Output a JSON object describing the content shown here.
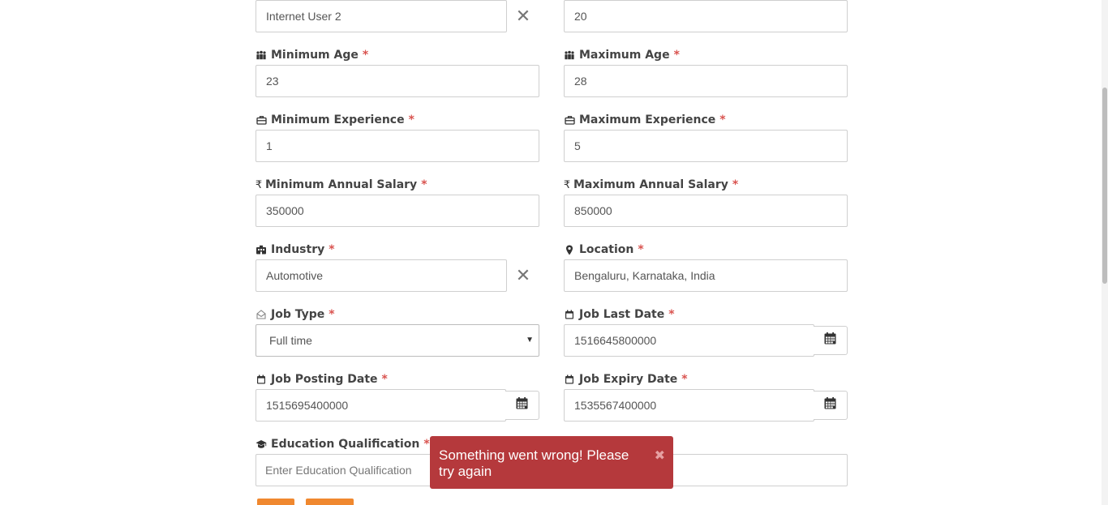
{
  "form": {
    "top_left_value": "Internet User 2",
    "top_right_value": "20",
    "min_age": {
      "label": "Minimum Age",
      "value": "23"
    },
    "max_age": {
      "label": "Maximum Age",
      "value": "28"
    },
    "min_experience": {
      "label": "Minimum Experience",
      "value": "1"
    },
    "max_experience": {
      "label": "Maximum Experience",
      "value": "5"
    },
    "min_salary": {
      "label": "Minimum Annual Salary",
      "value": "350000"
    },
    "max_salary": {
      "label": "Maximum Annual Salary",
      "value": "850000"
    },
    "industry": {
      "label": "Industry",
      "value": "Automotive"
    },
    "location": {
      "label": "Location",
      "value": "Bengaluru, Karnataka, India"
    },
    "job_type": {
      "label": "Job Type",
      "selected": "Full time"
    },
    "job_last_date": {
      "label": "Job Last Date",
      "value": "1516645800000"
    },
    "job_posting_date": {
      "label": "Job Posting Date",
      "value": "1515695400000"
    },
    "job_expiry_date": {
      "label": "Job Expiry Date",
      "value": "1535567400000"
    },
    "education": {
      "label": "Education Qualification",
      "placeholder": "Enter Education Qualification"
    },
    "required_mark": "*"
  },
  "toast": {
    "message": "Something went wrong! Please try again",
    "close_glyph": "✖",
    "color": "#b5393c"
  },
  "icons": {
    "clear": "✕",
    "rupee": "₹"
  }
}
